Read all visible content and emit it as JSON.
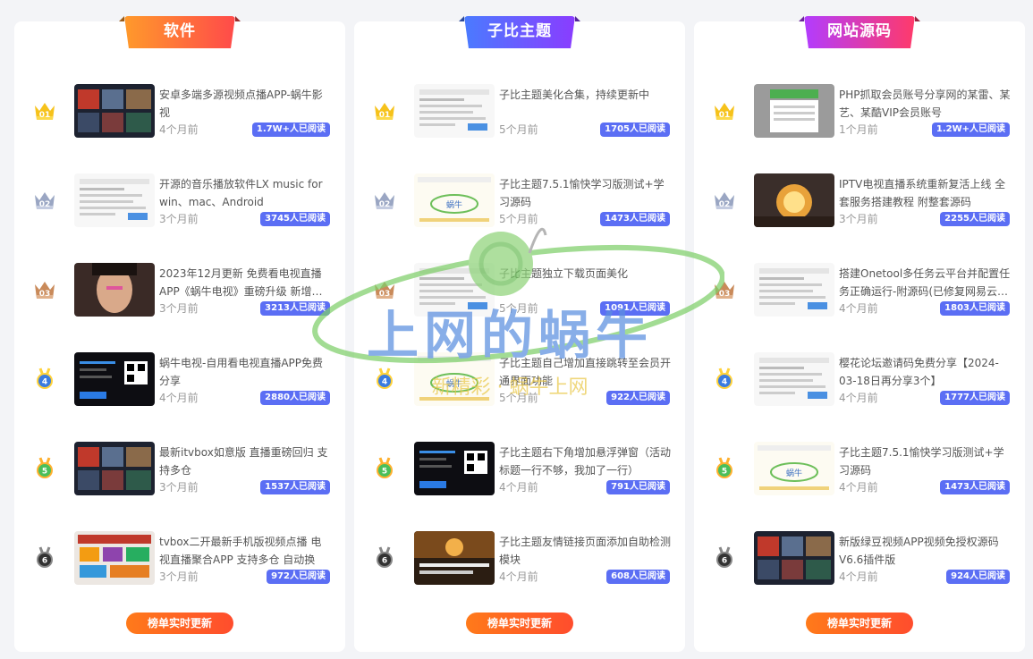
{
  "panels": [
    {
      "title": "软件",
      "colors": [
        "#ff9a2b",
        "#ff4a4a"
      ],
      "more_label": "榜单实时更新",
      "items": [
        {
          "rank": "01",
          "title": "安卓多端多源视频点播APP-蜗牛影视",
          "time": "4个月前",
          "reads": "1.7W+人已阅读",
          "thumb": "video-dark"
        },
        {
          "rank": "02",
          "title": "开源的音乐播放软件LX music for win、mac、Android",
          "time": "3个月前",
          "reads": "3745人已阅读",
          "thumb": "doc-white"
        },
        {
          "rank": "03",
          "title": "2023年12月更新 免费看电视直播APP《蜗牛电视》重磅升级 新增…",
          "time": "3个月前",
          "reads": "3213人已阅读",
          "thumb": "portrait"
        },
        {
          "rank": "4",
          "title": "蜗牛电视-自用看电视直播APP免费分享",
          "time": "4个月前",
          "reads": "2880人已阅读",
          "thumb": "dark-qr"
        },
        {
          "rank": "5",
          "title": "最新itvbox如意版 直播重磅回归 支持多仓",
          "time": "3个月前",
          "reads": "1537人已阅读",
          "thumb": "video-dark"
        },
        {
          "rank": "6",
          "title": "tvbox二开最新手机版视频点播 电视直播聚合APP 支持多仓 自动换源…",
          "time": "3个月前",
          "reads": "972人已阅读",
          "thumb": "colorful"
        }
      ]
    },
    {
      "title": "子比主题",
      "colors": [
        "#4a7bff",
        "#8a3cff"
      ],
      "more_label": "榜单实时更新",
      "items": [
        {
          "rank": "01",
          "title": "子比主题美化合集，持续更新中",
          "time": "5个月前",
          "reads": "1705人已阅读",
          "thumb": "doc-white"
        },
        {
          "rank": "02",
          "title": "子比主题7.5.1愉快学习版测试+学习源码",
          "time": "5个月前",
          "reads": "1473人已阅读",
          "thumb": "logo-white"
        },
        {
          "rank": "03",
          "title": "子比主题独立下载页面美化",
          "time": "5个月前",
          "reads": "1091人已阅读",
          "thumb": "doc-white"
        },
        {
          "rank": "4",
          "title": "子比主题自己增加直接跳转至会员开通界面功能",
          "time": "5个月前",
          "reads": "922人已阅读",
          "thumb": "logo-white"
        },
        {
          "rank": "5",
          "title": "子比主题右下角增加悬浮弹窗（活动标题一行不够，我加了一行）",
          "time": "4个月前",
          "reads": "791人已阅读",
          "thumb": "dark-qr"
        },
        {
          "rank": "6",
          "title": "子比主题友情链接页面添加自助检测模块",
          "time": "4个月前",
          "reads": "608人已阅读",
          "thumb": "warm"
        }
      ]
    },
    {
      "title": "网站源码",
      "colors": [
        "#b23cff",
        "#ff3a6a"
      ],
      "more_label": "榜单实时更新",
      "items": [
        {
          "rank": "01",
          "title": "PHP抓取会员账号分享网的某雷、某艺、某酷VIP会员账号",
          "time": "1个月前",
          "reads": "1.2W+人已阅读",
          "thumb": "gray-green"
        },
        {
          "rank": "02",
          "title": "IPTV电视直播系统重新复活上线 全套服务搭建教程 附整套源码",
          "time": "3个月前",
          "reads": "2255人已阅读",
          "thumb": "explosion"
        },
        {
          "rank": "03",
          "title": "搭建Onetool多任务云平台并配置任务正确运行-附源码(已修复网易云…",
          "time": "4个月前",
          "reads": "1803人已阅读",
          "thumb": "doc-white"
        },
        {
          "rank": "4",
          "title": "樱花论坛邀请码免费分享【2024-03-18日再分享3个】",
          "time": "4个月前",
          "reads": "1777人已阅读",
          "thumb": "doc-white"
        },
        {
          "rank": "5",
          "title": "子比主题7.5.1愉快学习版测试+学习源码",
          "time": "4个月前",
          "reads": "1473人已阅读",
          "thumb": "logo-white"
        },
        {
          "rank": "6",
          "title": "新版绿豆视频APP视频免授权源码V6.6插件版",
          "time": "4个月前",
          "reads": "924人已阅读",
          "thumb": "video-dark"
        }
      ]
    }
  ],
  "watermark": {
    "text": "上网的蜗牛",
    "sub": "新精彩 · 蜗牛上网"
  }
}
